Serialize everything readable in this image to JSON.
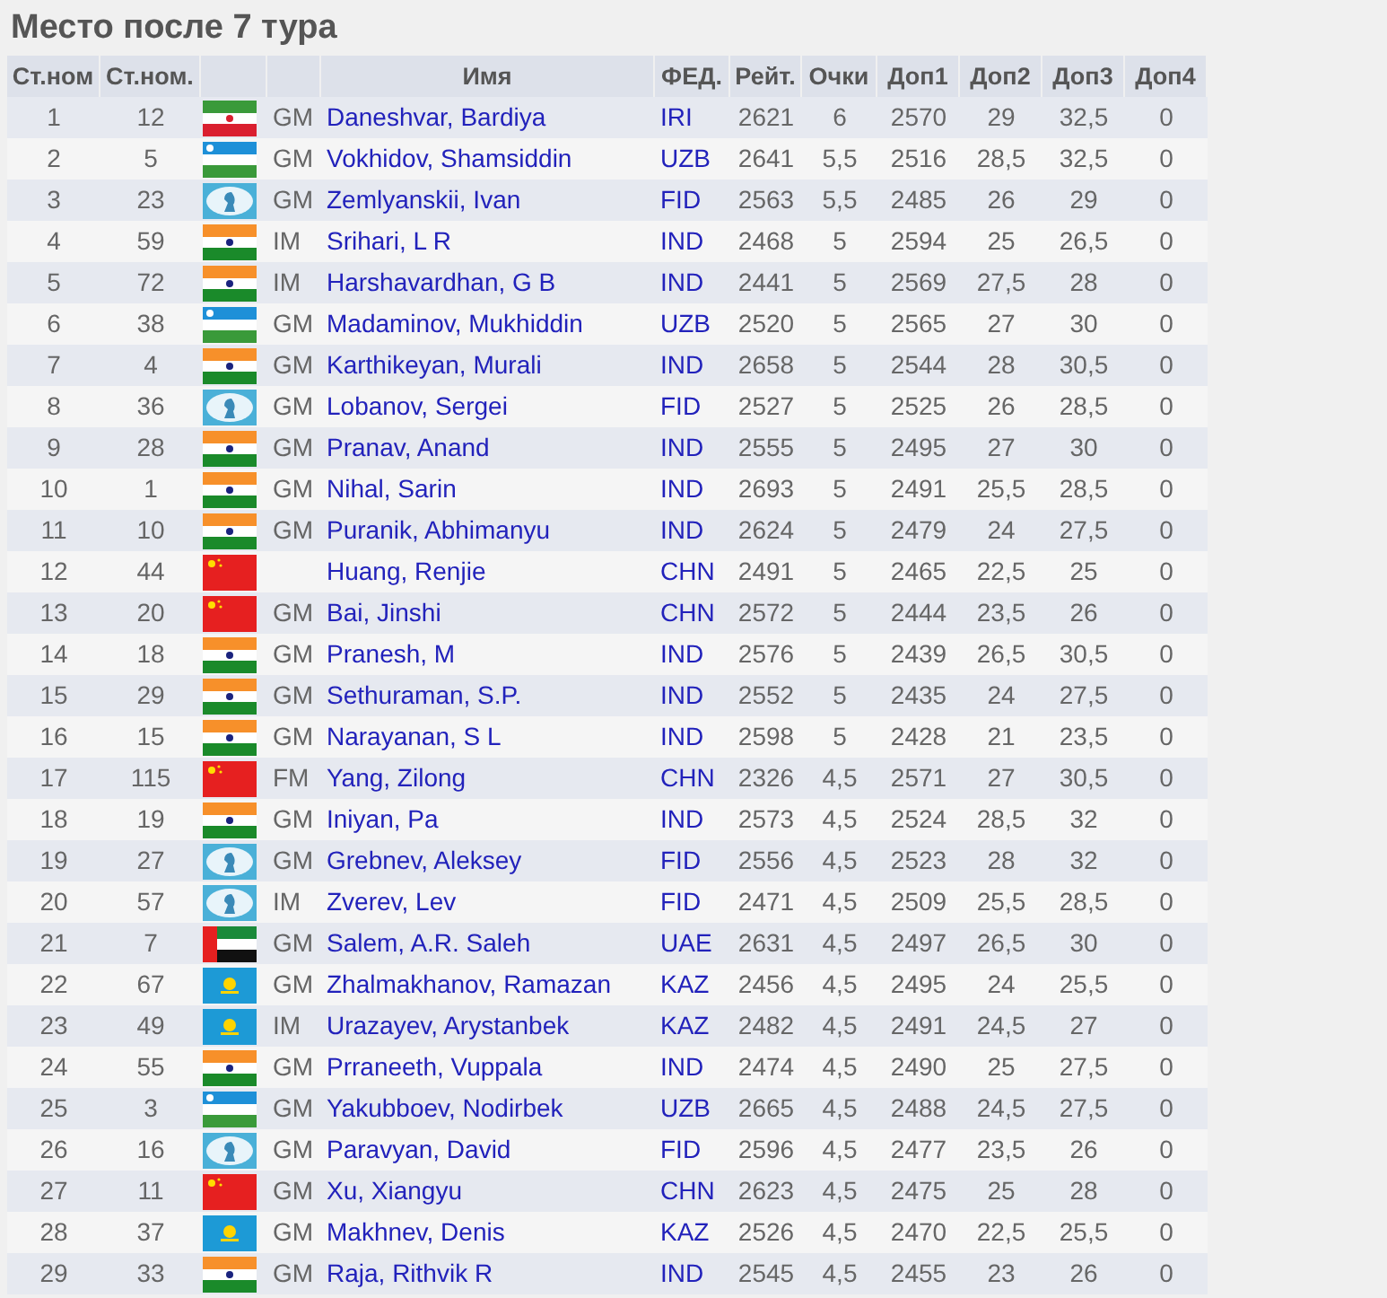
{
  "title": "Место после 7 тура",
  "columns": [
    "Ст.ном",
    "Ст.ном.",
    "",
    "",
    "Имя",
    "ФЕД.",
    "Рейт.",
    "Очки",
    "Доп1",
    "Доп2",
    "Доп3",
    "Доп4"
  ],
  "rows": [
    {
      "rank": "1",
      "start_no": "12",
      "kind": "iran",
      "title": "GM",
      "name": "Daneshvar, Bardiya",
      "fed": "IRI",
      "rating": "2621",
      "points": "6",
      "tb1": "2570",
      "tb2": "29",
      "tb3": "32,5",
      "tb4": "0"
    },
    {
      "rank": "2",
      "start_no": "5",
      "kind": "uzbekistan",
      "title": "GM",
      "name": "Vokhidov, Shamsiddin",
      "fed": "UZB",
      "rating": "2641",
      "points": "5,5",
      "tb1": "2516",
      "tb2": "28,5",
      "tb3": "32,5",
      "tb4": "0"
    },
    {
      "rank": "3",
      "start_no": "23",
      "kind": "fide",
      "title": "GM",
      "name": "Zemlyanskii, Ivan",
      "fed": "FID",
      "rating": "2563",
      "points": "5,5",
      "tb1": "2485",
      "tb2": "26",
      "tb3": "29",
      "tb4": "0"
    },
    {
      "rank": "4",
      "start_no": "59",
      "kind": "india",
      "title": "IM",
      "name": "Srihari, L R",
      "fed": "IND",
      "rating": "2468",
      "points": "5",
      "tb1": "2594",
      "tb2": "25",
      "tb3": "26,5",
      "tb4": "0"
    },
    {
      "rank": "5",
      "start_no": "72",
      "kind": "india",
      "title": "IM",
      "name": "Harshavardhan, G B",
      "fed": "IND",
      "rating": "2441",
      "points": "5",
      "tb1": "2569",
      "tb2": "27,5",
      "tb3": "28",
      "tb4": "0"
    },
    {
      "rank": "6",
      "start_no": "38",
      "kind": "uzbekistan",
      "title": "GM",
      "name": "Madaminov, Mukhiddin",
      "fed": "UZB",
      "rating": "2520",
      "points": "5",
      "tb1": "2565",
      "tb2": "27",
      "tb3": "30",
      "tb4": "0"
    },
    {
      "rank": "7",
      "start_no": "4",
      "kind": "india",
      "title": "GM",
      "name": "Karthikeyan, Murali",
      "fed": "IND",
      "rating": "2658",
      "points": "5",
      "tb1": "2544",
      "tb2": "28",
      "tb3": "30,5",
      "tb4": "0"
    },
    {
      "rank": "8",
      "start_no": "36",
      "kind": "fide",
      "title": "GM",
      "name": "Lobanov, Sergei",
      "fed": "FID",
      "rating": "2527",
      "points": "5",
      "tb1": "2525",
      "tb2": "26",
      "tb3": "28,5",
      "tb4": "0"
    },
    {
      "rank": "9",
      "start_no": "28",
      "kind": "india",
      "title": "GM",
      "name": "Pranav, Anand",
      "fed": "IND",
      "rating": "2555",
      "points": "5",
      "tb1": "2495",
      "tb2": "27",
      "tb3": "30",
      "tb4": "0"
    },
    {
      "rank": "10",
      "start_no": "1",
      "kind": "india",
      "title": "GM",
      "name": "Nihal, Sarin",
      "fed": "IND",
      "rating": "2693",
      "points": "5",
      "tb1": "2491",
      "tb2": "25,5",
      "tb3": "28,5",
      "tb4": "0"
    },
    {
      "rank": "11",
      "start_no": "10",
      "kind": "india",
      "title": "GM",
      "name": "Puranik, Abhimanyu",
      "fed": "IND",
      "rating": "2624",
      "points": "5",
      "tb1": "2479",
      "tb2": "24",
      "tb3": "27,5",
      "tb4": "0"
    },
    {
      "rank": "12",
      "start_no": "44",
      "kind": "china",
      "name": "Huang, Renjie",
      "fed": "CHN",
      "rating": "2491",
      "points": "5",
      "tb1": "2465",
      "tb2": "22,5",
      "tb3": "25",
      "tb4": "0"
    },
    {
      "rank": "13",
      "start_no": "20",
      "kind": "china",
      "title": "GM",
      "name": "Bai, Jinshi",
      "fed": "CHN",
      "rating": "2572",
      "points": "5",
      "tb1": "2444",
      "tb2": "23,5",
      "tb3": "26",
      "tb4": "0"
    },
    {
      "rank": "14",
      "start_no": "18",
      "kind": "india",
      "title": "GM",
      "name": "Pranesh, M",
      "fed": "IND",
      "rating": "2576",
      "points": "5",
      "tb1": "2439",
      "tb2": "26,5",
      "tb3": "30,5",
      "tb4": "0"
    },
    {
      "rank": "15",
      "start_no": "29",
      "kind": "india",
      "title": "GM",
      "name": "Sethuraman, S.P.",
      "fed": "IND",
      "rating": "2552",
      "points": "5",
      "tb1": "2435",
      "tb2": "24",
      "tb3": "27,5",
      "tb4": "0"
    },
    {
      "rank": "16",
      "start_no": "15",
      "kind": "india",
      "title": "GM",
      "name": "Narayanan, S L",
      "fed": "IND",
      "rating": "2598",
      "points": "5",
      "tb1": "2428",
      "tb2": "21",
      "tb3": "23,5",
      "tb4": "0"
    },
    {
      "rank": "17",
      "start_no": "115",
      "kind": "china",
      "title": "FM",
      "name": "Yang, Zilong",
      "fed": "CHN",
      "rating": "2326",
      "points": "4,5",
      "tb1": "2571",
      "tb2": "27",
      "tb3": "30,5",
      "tb4": "0"
    },
    {
      "rank": "18",
      "start_no": "19",
      "kind": "india",
      "title": "GM",
      "name": "Iniyan, Pa",
      "fed": "IND",
      "rating": "2573",
      "points": "4,5",
      "tb1": "2524",
      "tb2": "28,5",
      "tb3": "32",
      "tb4": "0"
    },
    {
      "rank": "19",
      "start_no": "27",
      "kind": "fide",
      "title": "GM",
      "name": "Grebnev, Aleksey",
      "fed": "FID",
      "rating": "2556",
      "points": "4,5",
      "tb1": "2523",
      "tb2": "28",
      "tb3": "32",
      "tb4": "0"
    },
    {
      "rank": "20",
      "start_no": "57",
      "kind": "fide",
      "title": "IM",
      "name": "Zverev, Lev",
      "fed": "FID",
      "rating": "2471",
      "points": "4,5",
      "tb1": "2509",
      "tb2": "25,5",
      "tb3": "28,5",
      "tb4": "0"
    },
    {
      "rank": "21",
      "start_no": "7",
      "kind": "uae",
      "title": "GM",
      "name": "Salem, A.R. Saleh",
      "fed": "UAE",
      "rating": "2631",
      "points": "4,5",
      "tb1": "2497",
      "tb2": "26,5",
      "tb3": "30",
      "tb4": "0"
    },
    {
      "rank": "22",
      "start_no": "67",
      "kind": "kazakhstan",
      "title": "GM",
      "name": "Zhalmakhanov, Ramazan",
      "fed": "KAZ",
      "rating": "2456",
      "points": "4,5",
      "tb1": "2495",
      "tb2": "24",
      "tb3": "25,5",
      "tb4": "0"
    },
    {
      "rank": "23",
      "start_no": "49",
      "kind": "kazakhstan",
      "title": "IM",
      "name": "Urazayev, Arystanbek",
      "fed": "KAZ",
      "rating": "2482",
      "points": "4,5",
      "tb1": "2491",
      "tb2": "24,5",
      "tb3": "27",
      "tb4": "0"
    },
    {
      "rank": "24",
      "start_no": "55",
      "kind": "india",
      "title": "GM",
      "name": "Prraneeth, Vuppala",
      "fed": "IND",
      "rating": "2474",
      "points": "4,5",
      "tb1": "2490",
      "tb2": "25",
      "tb3": "27,5",
      "tb4": "0"
    },
    {
      "rank": "25",
      "start_no": "3",
      "kind": "uzbekistan",
      "title": "GM",
      "name": "Yakubboev, Nodirbek",
      "fed": "UZB",
      "rating": "2665",
      "points": "4,5",
      "tb1": "2488",
      "tb2": "24,5",
      "tb3": "27,5",
      "tb4": "0"
    },
    {
      "rank": "26",
      "start_no": "16",
      "kind": "fide",
      "title": "GM",
      "name": "Paravyan, David",
      "fed": "FID",
      "rating": "2596",
      "points": "4,5",
      "tb1": "2477",
      "tb2": "23,5",
      "tb3": "26",
      "tb4": "0"
    },
    {
      "rank": "27",
      "start_no": "11",
      "kind": "china",
      "title": "GM",
      "name": "Xu, Xiangyu",
      "fed": "CHN",
      "rating": "2623",
      "points": "4,5",
      "tb1": "2475",
      "tb2": "25",
      "tb3": "28",
      "tb4": "0"
    },
    {
      "rank": "28",
      "start_no": "37",
      "kind": "kazakhstan",
      "title": "GM",
      "name": "Makhnev, Denis",
      "fed": "KAZ",
      "rating": "2526",
      "points": "4,5",
      "tb1": "2470",
      "tb2": "22,5",
      "tb3": "25,5",
      "tb4": "0"
    },
    {
      "rank": "29",
      "start_no": "33",
      "kind": "india",
      "title": "GM",
      "name": "Raja, Rithvik R",
      "fed": "IND",
      "rating": "2545",
      "points": "4,5",
      "tb1": "2455",
      "tb2": "23",
      "tb3": "26",
      "tb4": "0"
    }
  ]
}
